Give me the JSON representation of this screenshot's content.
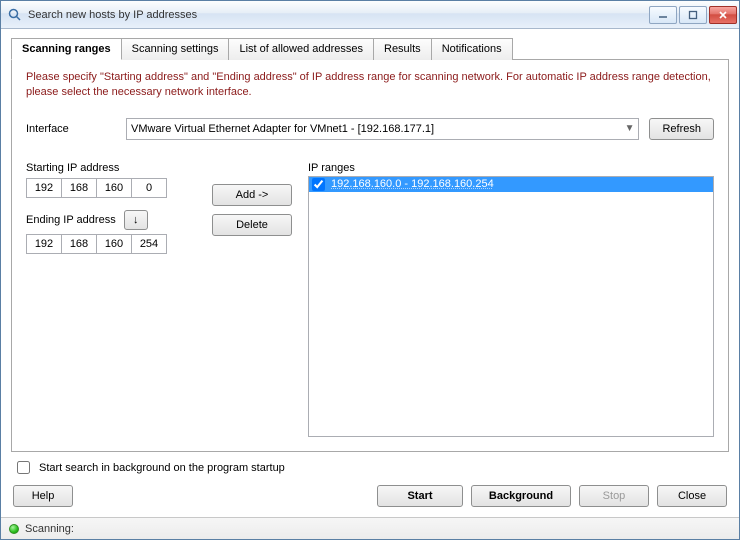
{
  "window": {
    "title": "Search new hosts by IP addresses"
  },
  "tabs": [
    {
      "label": "Scanning ranges"
    },
    {
      "label": "Scanning settings"
    },
    {
      "label": "List of allowed addresses"
    },
    {
      "label": "Results"
    },
    {
      "label": "Notifications"
    }
  ],
  "instructions": "Please specify \"Starting address\" and \"Ending address\" of IP address range for scanning network. For automatic IP address range detection, please select the necessary network interface.",
  "interface": {
    "label": "Interface",
    "value": "VMware Virtual Ethernet Adapter for VMnet1 - [192.168.177.1]",
    "refresh": "Refresh"
  },
  "start_ip": {
    "label": "Starting IP address",
    "oct": [
      "192",
      "168",
      "160",
      "0"
    ]
  },
  "end_ip": {
    "label": "Ending IP address",
    "oct": [
      "192",
      "168",
      "160",
      "254"
    ]
  },
  "buttons": {
    "add": "Add ->",
    "delete": "Delete"
  },
  "ranges": {
    "label": "IP ranges",
    "items": [
      {
        "checked": true,
        "text": "192.168.160.0 - 192.168.160.254",
        "selected": true
      }
    ]
  },
  "checkbox_startup": {
    "label": "Start search in background on the program startup",
    "checked": false
  },
  "action_buttons": {
    "help": "Help",
    "start": "Start",
    "background": "Background",
    "stop": "Stop",
    "close": "Close"
  },
  "status": {
    "text": "Scanning:"
  }
}
